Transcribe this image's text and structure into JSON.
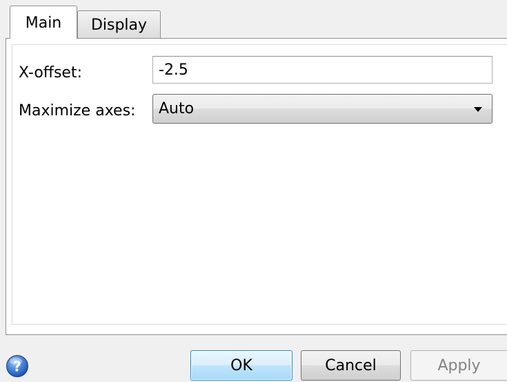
{
  "tabs": [
    {
      "label": "Main",
      "active": true
    },
    {
      "label": "Display",
      "active": false
    }
  ],
  "main": {
    "xoffset_label": "X-offset:",
    "xoffset_value": "-2.5",
    "maximize_label": "Maximize axes:",
    "maximize_value": "Auto"
  },
  "buttons": {
    "ok": "OK",
    "cancel": "Cancel",
    "apply": "Apply"
  },
  "icons": {
    "help": "help-icon",
    "dropdown": "chevron-down-icon"
  },
  "colors": {
    "ok_border": "#3c7fb1",
    "help_blue": "#3a70c9"
  }
}
